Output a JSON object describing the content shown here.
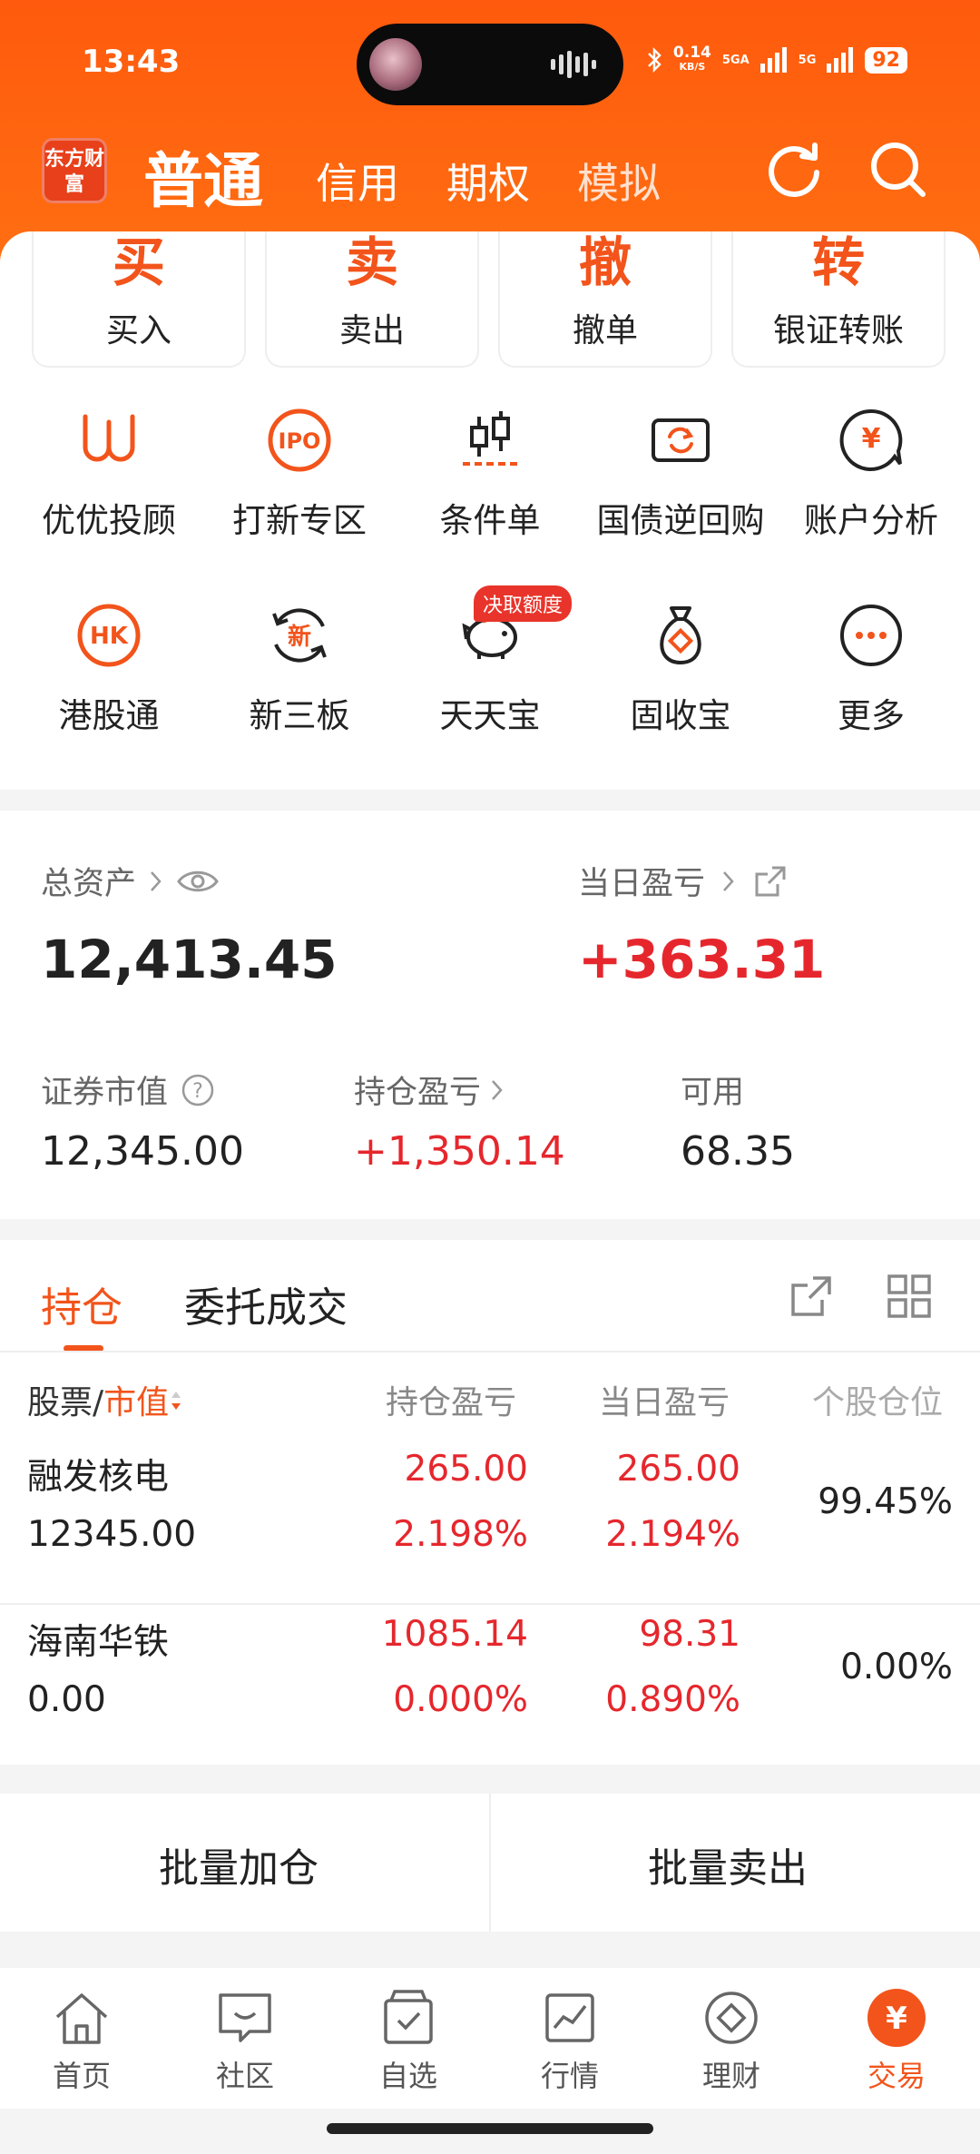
{
  "status": {
    "time": "13:43",
    "net_speed": "0.14",
    "net_unit": "KB/S",
    "signal1": "5GA",
    "signal2": "5G",
    "battery": "92"
  },
  "header": {
    "logo": "东方财富",
    "tabs": [
      {
        "label": "普通"
      },
      {
        "label": "信用"
      },
      {
        "label": "期权"
      },
      {
        "label": "模拟"
      }
    ]
  },
  "trade_buttons": [
    {
      "big": "买",
      "label": "买入"
    },
    {
      "big": "卖",
      "label": "卖出"
    },
    {
      "big": "撤",
      "label": "撤单"
    },
    {
      "big": "转",
      "label": "银证转账"
    }
  ],
  "grid": [
    {
      "label": "优优投顾",
      "icon": "uu-advisor-icon"
    },
    {
      "label": "打新专区",
      "icon": "ipo-icon"
    },
    {
      "label": "条件单",
      "icon": "candlestick-icon"
    },
    {
      "label": "国债逆回购",
      "icon": "repo-ticket-icon"
    },
    {
      "label": "账户分析",
      "icon": "yen-chat-icon"
    },
    {
      "label": "港股通",
      "icon": "hk-icon"
    },
    {
      "label": "新三板",
      "icon": "new-board-icon"
    },
    {
      "label": "天天宝",
      "icon": "piggy-bank-icon"
    },
    {
      "label": "固收宝",
      "icon": "money-bag-icon"
    },
    {
      "label": "更多",
      "icon": "more-icon"
    }
  ],
  "badge": "决取额度",
  "assets": {
    "total_label": "总资产",
    "total_value": "12,413.45",
    "daily_label": "当日盈亏",
    "daily_value": "+363.31",
    "market_label": "证券市值",
    "market_value": "12,345.00",
    "holding_label": "持仓盈亏",
    "holding_value": "+1,350.14",
    "available_label": "可用",
    "available_value": "68.35"
  },
  "holdings": {
    "tabs": [
      "持仓",
      "委托成交"
    ],
    "headers": {
      "stock": "股票",
      "slash": "/",
      "mv": "市值",
      "pnl": "持仓盈亏",
      "daily": "当日盈亏",
      "position": "个股仓位"
    },
    "rows": [
      {
        "name": "融发核电",
        "market_value": "12345.00",
        "pnl": "265.00",
        "pnl_pct": "2.198%",
        "daily": "265.00",
        "daily_pct": "2.194%",
        "position": "99.45%"
      },
      {
        "name": "海南华铁",
        "market_value": "0.00",
        "pnl": "1085.14",
        "pnl_pct": "0.000%",
        "daily": "98.31",
        "daily_pct": "0.890%",
        "position": "0.00%"
      }
    ]
  },
  "actions": {
    "add": "批量加仓",
    "sell": "批量卖出"
  },
  "tabbar": [
    {
      "label": "首页"
    },
    {
      "label": "社区"
    },
    {
      "label": "自选"
    },
    {
      "label": "行情"
    },
    {
      "label": "理财"
    },
    {
      "label": "交易"
    }
  ],
  "colors": {
    "accent": "#ff5a0d",
    "red": "#e5272d"
  }
}
